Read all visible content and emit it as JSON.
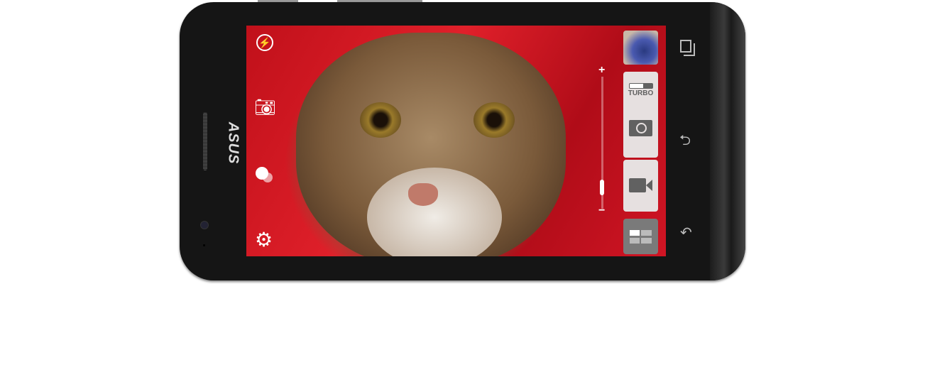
{
  "brand": "ASUS",
  "camera": {
    "left_icons": [
      "flash-icon",
      "switch-camera-icon",
      "effects-icon",
      "settings-icon"
    ],
    "zoom": {
      "plus": "+",
      "minus": "−",
      "level": 0.1
    },
    "turbo_label": "TURBO",
    "modes": [
      "thumbnail",
      "photo",
      "video",
      "mode-grid"
    ]
  },
  "nav_icons": [
    "recent-apps-icon",
    "back-icon",
    "return-icon"
  ],
  "colors": {
    "panel": "#e6e0e0",
    "icon": "#616161",
    "body": "#151515"
  }
}
